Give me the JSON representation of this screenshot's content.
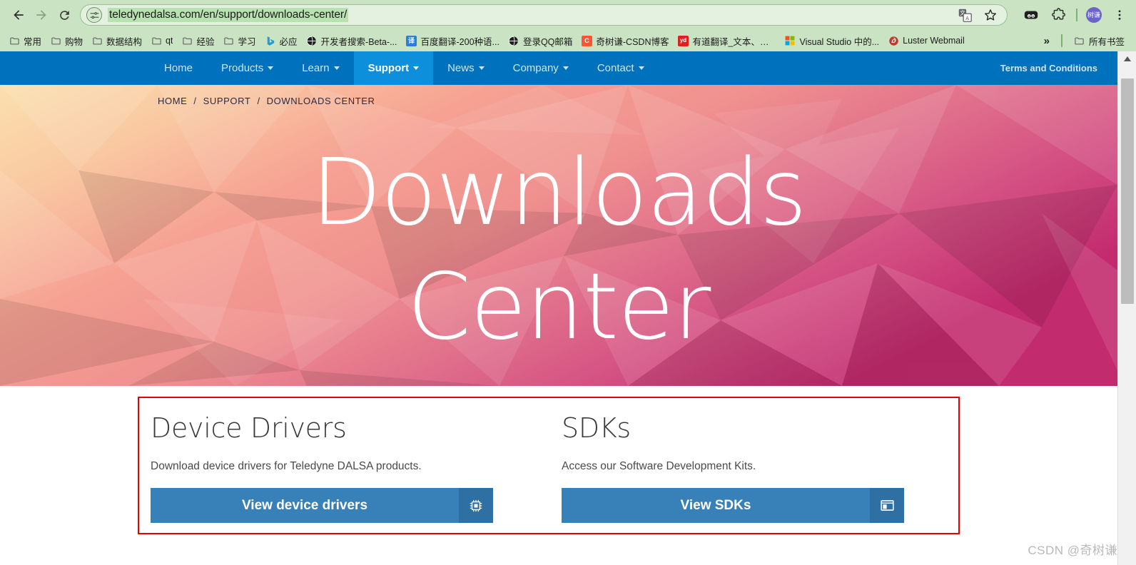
{
  "browser": {
    "back_tooltip": "Back",
    "forward_tooltip": "Forward",
    "reload_tooltip": "Reload",
    "url": "teledynedalsa.com/en/support/downloads-center/",
    "site_settings_icon": "tune-icon",
    "translate_icon": "translate-icon",
    "bookmark_icon": "star-icon",
    "extension_icon": "extension-panda-icon",
    "puzzle_icon": "puzzle-extensions-icon",
    "menu_icon": "three-dots-menu-icon",
    "profile_initials": "树谦",
    "bookmarks": [
      {
        "label": "常用",
        "icon": "folder-icon"
      },
      {
        "label": "购物",
        "icon": "folder-icon"
      },
      {
        "label": "数据结构",
        "icon": "folder-icon"
      },
      {
        "label": "qt",
        "icon": "folder-icon"
      },
      {
        "label": "经验",
        "icon": "folder-icon"
      },
      {
        "label": "学习",
        "icon": "folder-icon"
      },
      {
        "label": "必应",
        "icon": "bing-icon"
      },
      {
        "label": "开发者搜索-Beta-...",
        "icon": "globe-icon"
      },
      {
        "label": "百度翻译-200种语...",
        "icon": "baidu-translate-icon"
      },
      {
        "label": "登录QQ邮箱",
        "icon": "globe-icon"
      },
      {
        "label": "奇树谦-CSDN博客",
        "icon": "csdn-icon"
      },
      {
        "label": "有道翻译_文本、文...",
        "icon": "youdao-icon"
      },
      {
        "label": "Visual Studio 中的...",
        "icon": "microsoft-icon"
      },
      {
        "label": "Luster Webmail",
        "icon": "luster-icon"
      }
    ],
    "overflow_label": "»",
    "all_bookmarks_label": "所有书签",
    "all_bookmarks_icon": "folder-icon"
  },
  "site": {
    "nav": {
      "items": [
        {
          "label": "Home",
          "has_caret": false,
          "active": false
        },
        {
          "label": "Products",
          "has_caret": true,
          "active": false
        },
        {
          "label": "Learn",
          "has_caret": true,
          "active": false
        },
        {
          "label": "Support",
          "has_caret": true,
          "active": true
        },
        {
          "label": "News",
          "has_caret": true,
          "active": false
        },
        {
          "label": "Company",
          "has_caret": true,
          "active": false
        },
        {
          "label": "Contact",
          "has_caret": true,
          "active": false
        }
      ],
      "terms_label": "Terms and Conditions",
      "bar_color": "#0071bc",
      "active_color": "#0d8fdb"
    },
    "breadcrumb": {
      "items": [
        "HOME",
        "SUPPORT",
        "DOWNLOADS CENTER"
      ],
      "separator": "/"
    },
    "hero": {
      "title_line1": "Downloads",
      "title_line2": "Center"
    },
    "cards": [
      {
        "title": "Device Drivers",
        "description": "Download device drivers for Teledyne DALSA products.",
        "button_label": "View device drivers",
        "button_icon": "microchip-icon",
        "button_color": "#3880b8"
      },
      {
        "title": "SDKs",
        "description": "Access our Software Development Kits.",
        "button_label": "View SDKs",
        "button_icon": "window-layout-icon",
        "button_color": "#3880b8"
      }
    ],
    "annotation": {
      "box_color": "#e60000"
    }
  },
  "scrollbar": {
    "up_arrow_icon": "triangle-up-icon"
  },
  "watermark": "CSDN @奇树谦"
}
